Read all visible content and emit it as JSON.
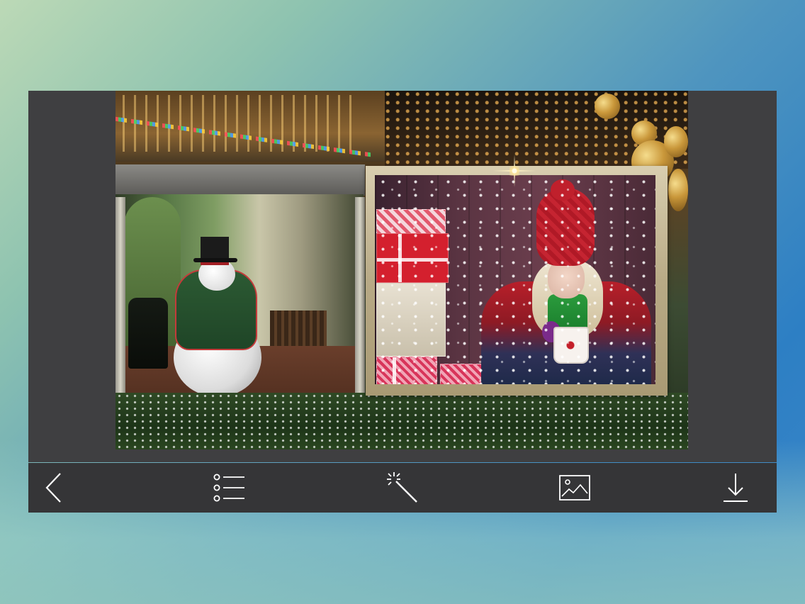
{
  "app": {
    "screen": "photo-frame-editor"
  },
  "canvas": {
    "background_scene": "christmas-porch-with-snowman",
    "inset_photo": "child-in-red-knit-hat-with-gifts"
  },
  "toolbar": {
    "items": [
      {
        "name": "back",
        "icon": "chevron-left-icon"
      },
      {
        "name": "frames-list",
        "icon": "list-icon"
      },
      {
        "name": "effects",
        "icon": "magic-wand-icon"
      },
      {
        "name": "gallery",
        "icon": "image-icon"
      },
      {
        "name": "save",
        "icon": "download-icon"
      }
    ]
  },
  "colors": {
    "panel": "#3f3f41",
    "toolbar": "#353537",
    "icon": "#ffffff",
    "frame": "#c9bc98"
  }
}
